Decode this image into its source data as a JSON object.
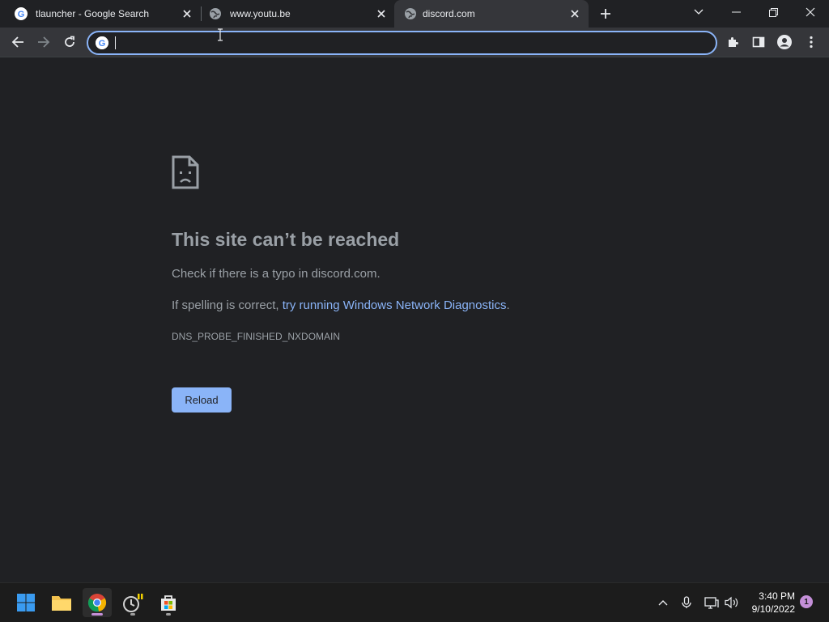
{
  "tabs": [
    {
      "title": "tlauncher - Google Search",
      "favicon": "google-icon"
    },
    {
      "title": "www.youtu.be",
      "favicon": "globe-icon"
    },
    {
      "title": "discord.com",
      "favicon": "globe-icon",
      "active": true
    }
  ],
  "address_bar": {
    "value": "",
    "placeholder": ""
  },
  "error_page": {
    "title": "This site can’t be reached",
    "line1": "Check if there is a typo in discord.com.",
    "line2_prefix": "If spelling is correct, ",
    "line2_link": "try running Windows Network Diagnostics",
    "line2_suffix": ".",
    "error_code": "DNS_PROBE_FINISHED_NXDOMAIN",
    "reload_label": "Reload"
  },
  "taskbar": {
    "time": "3:40 PM",
    "date": "9/10/2022",
    "notification_count": "1"
  },
  "colors": {
    "background": "#202124",
    "toolbar": "#35363a",
    "accent": "#8ab4f8",
    "muted_text": "#9aa0a6"
  }
}
